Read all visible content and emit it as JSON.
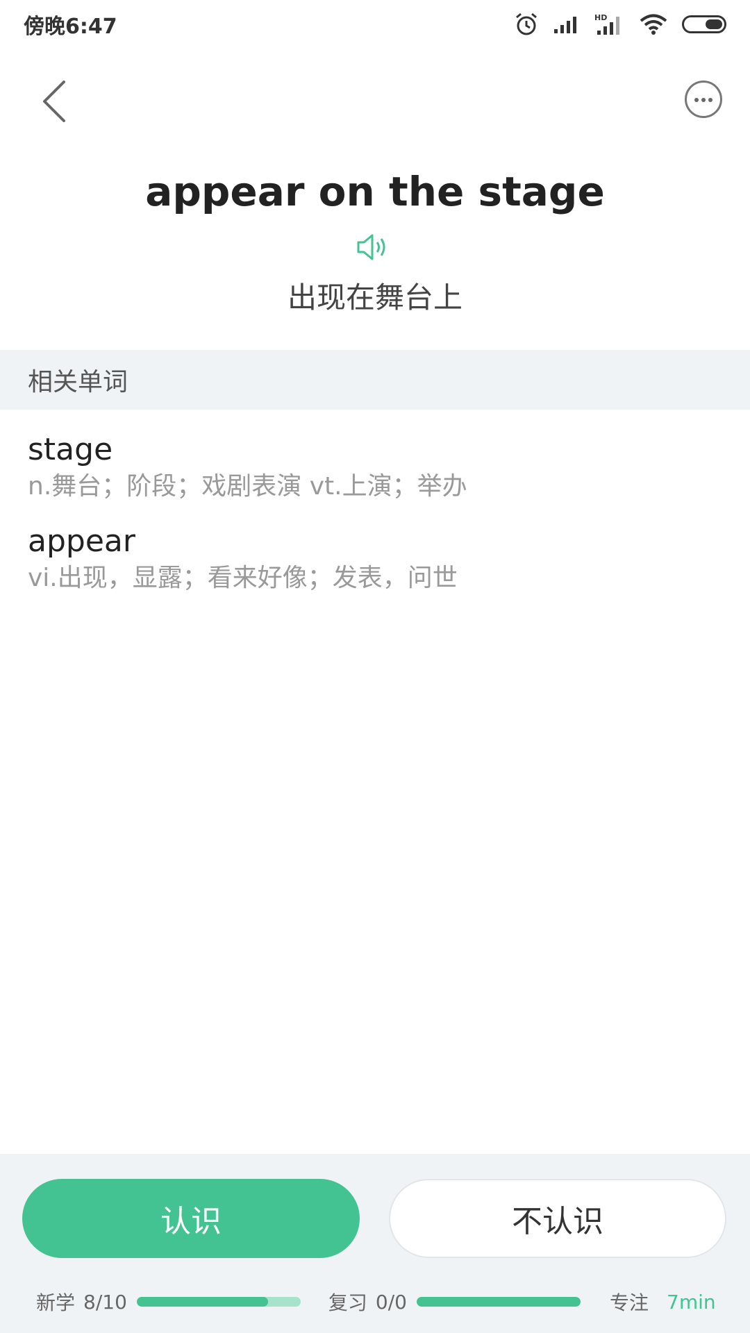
{
  "status_bar": {
    "time": "傍晚6:47"
  },
  "icons": {
    "back": "chevron-left-icon",
    "more": "more-dots-icon",
    "speaker": "speaker-icon",
    "alarm": "alarm-icon",
    "signal": "signal-icon",
    "wifi": "wifi-icon",
    "battery": "battery-icon"
  },
  "phrase": {
    "text": "appear on the stage",
    "translation": "出现在舞台上"
  },
  "related": {
    "header": "相关单词",
    "items": [
      {
        "word": "stage",
        "definition": "n.舞台；阶段；戏剧表演 vt.上演；举办"
      },
      {
        "word": "appear",
        "definition": "vi.出现，显露；看来好像；发表，问世"
      }
    ]
  },
  "buttons": {
    "know": "认识",
    "unknown": "不认识"
  },
  "stats": {
    "new_label": "新学",
    "new_count": "8/10",
    "new_progress": 0.8,
    "review_label": "复习",
    "review_count": "0/0",
    "review_progress": 1.0,
    "focus_label": "专注",
    "focus_value": "7min"
  },
  "colors": {
    "accent": "#43c392",
    "accent_light": "#a7e3cb",
    "panel_bg": "#f0f3f6"
  }
}
